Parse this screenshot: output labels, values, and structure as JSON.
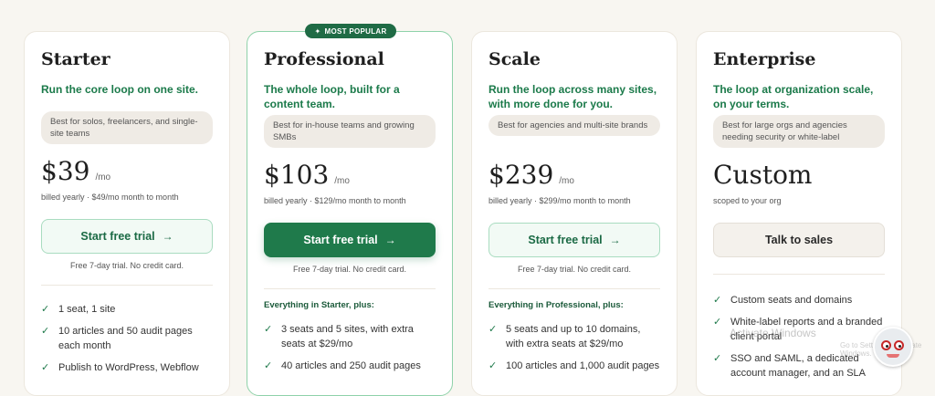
{
  "badge": "MOST POPULAR",
  "plans": [
    {
      "name": "Starter",
      "tagline": "Run the core loop on one site.",
      "best_for": "Best for solos, freelancers, and single-site teams",
      "price": "$39",
      "per": "/mo",
      "billing": "billed yearly · $49/mo month to month",
      "cta": "Start free trial",
      "note": "Free 7-day trial. No credit card.",
      "features_head": "",
      "features": [
        "1 seat, 1 site",
        "10 articles and 50 audit pages each month",
        "Publish to WordPress, Webflow"
      ]
    },
    {
      "name": "Professional",
      "tagline": "The whole loop, built for a content team.",
      "best_for": "Best for in-house teams and growing SMBs",
      "price": "$103",
      "per": "/mo",
      "billing": "billed yearly · $129/mo month to month",
      "cta": "Start free trial",
      "note": "Free 7-day trial. No credit card.",
      "features_head": "Everything in Starter, plus:",
      "features": [
        "3 seats and 5 sites, with extra seats at $29/mo",
        "40 articles and 250 audit pages"
      ]
    },
    {
      "name": "Scale",
      "tagline": "Run the loop across many sites, with more done for you.",
      "best_for": "Best for agencies and multi-site brands",
      "price": "$239",
      "per": "/mo",
      "billing": "billed yearly · $299/mo month to month",
      "cta": "Start free trial",
      "note": "Free 7-day trial. No credit card.",
      "features_head": "Everything in Professional, plus:",
      "features": [
        "5 seats and up to 10 domains, with extra seats at $29/mo",
        "100 articles and 1,000 audit pages"
      ]
    },
    {
      "name": "Enterprise",
      "tagline": "The loop at organization scale, on your terms.",
      "best_for": "Best for large orgs and agencies needing security or white-label",
      "price": "Custom",
      "per": "",
      "billing": "scoped to your org",
      "cta": "Talk to sales",
      "note": "",
      "features_head": "",
      "features": [
        "Custom seats and domains",
        "White-label reports and a branded client portal",
        "SSO and SAML, a dedicated account manager, and an SLA"
      ]
    }
  ],
  "watermark": {
    "line1": "Activate Windows",
    "line2": "Go to Settings to activate Windows."
  },
  "icons": {
    "check": "check-icon",
    "arrow": "arrow-right-icon",
    "badge": "sparkle-icon"
  },
  "colors": {
    "accent": "#1f7a4b",
    "background": "#f8f6f1"
  }
}
